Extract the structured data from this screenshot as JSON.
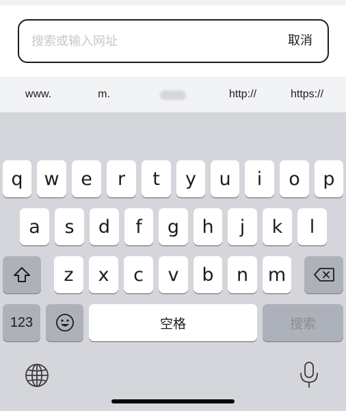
{
  "search": {
    "placeholder": "搜索或输入网址",
    "value": "",
    "cancel_label": "取消"
  },
  "suggestions": [
    "www.",
    "m.",
    "http://",
    "https://"
  ],
  "keyboard": {
    "row1": [
      "q",
      "w",
      "e",
      "r",
      "t",
      "y",
      "u",
      "i",
      "o",
      "p"
    ],
    "row2": [
      "a",
      "s",
      "d",
      "f",
      "g",
      "h",
      "j",
      "k",
      "l"
    ],
    "row3": [
      "z",
      "x",
      "c",
      "v",
      "b",
      "n",
      "m"
    ],
    "numbers_label": "123",
    "space_label": "空格",
    "search_label": "搜索",
    "icons": {
      "shift": "shift-icon",
      "delete": "backspace-icon",
      "emoji": "emoji-icon",
      "globe": "globe-icon",
      "mic": "microphone-icon"
    }
  },
  "colors": {
    "keyboard_bg": "#d4d6db",
    "key_bg": "#ffffff",
    "function_key_bg": "#adb1b9",
    "suggestion_bar_bg": "#f2f3f5",
    "text": "#1c1c1e",
    "placeholder": "#c7c7cc"
  }
}
